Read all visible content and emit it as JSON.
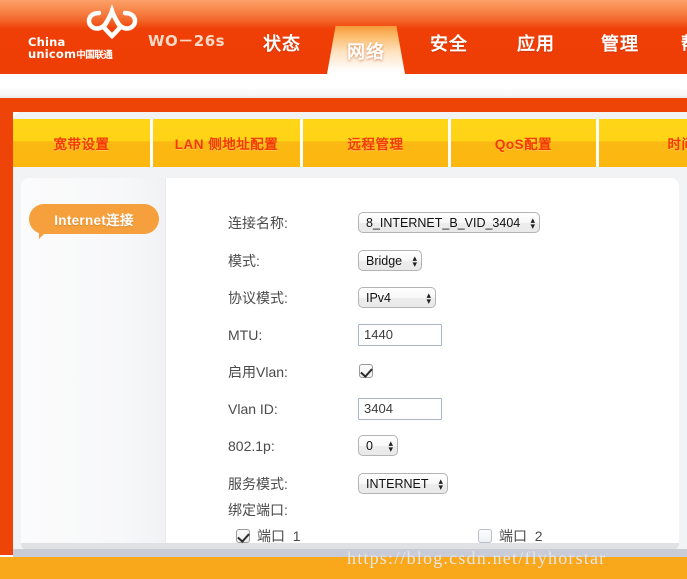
{
  "header": {
    "brand": {
      "line1": "China",
      "line2": "unicom",
      "line2_cn": "中国联通",
      "logo_icon": "unicom-knot-icon"
    },
    "model": "WO－26s",
    "nav": [
      {
        "label": "状态",
        "active": false
      },
      {
        "label": "网络",
        "active": true
      },
      {
        "label": "安全",
        "active": false
      },
      {
        "label": "应用",
        "active": false
      },
      {
        "label": "管理",
        "active": false
      },
      {
        "label": "帮",
        "active": false
      }
    ]
  },
  "subtabs": [
    {
      "label": "宽带设置"
    },
    {
      "label": "LAN 侧地址配置"
    },
    {
      "label": "远程管理"
    },
    {
      "label": "QoS配置"
    },
    {
      "label": "时间管理"
    }
  ],
  "sidebar": {
    "items": [
      {
        "label": "Internet连接",
        "active": true
      }
    ]
  },
  "form": {
    "rows": [
      {
        "label": "连接名称:",
        "type": "select",
        "value": "8_INTERNET_B_VID_3404"
      },
      {
        "label": "模式:",
        "type": "select",
        "value": "Bridge"
      },
      {
        "label": "协议模式:",
        "type": "select",
        "value": "IPv4"
      },
      {
        "label": "MTU:",
        "type": "text",
        "value": "1440"
      },
      {
        "label": "启用Vlan:",
        "type": "checkbox",
        "checked": true
      },
      {
        "label": "Vlan ID:",
        "type": "text",
        "value": "3404"
      },
      {
        "label": "802.1p:",
        "type": "select",
        "value": "0"
      },
      {
        "label": "服务模式:",
        "type": "select",
        "value": "INTERNET"
      },
      {
        "label": "绑定端口:",
        "type": "label"
      }
    ],
    "ports": [
      {
        "label": "端口_1",
        "checked": true
      },
      {
        "label": "端口_2",
        "checked": false
      }
    ]
  },
  "watermark": "https://blog.csdn.net/flyhorstar",
  "colors": {
    "header_orange": "#ee3d05",
    "frame_orange": "#ef4408",
    "bottom_amber": "#f9a81c",
    "subtab_yellow": "#ffd518",
    "subtab_amber": "#fcb70f",
    "subtab_text": "#f23b00",
    "sidebar_active": "#f5a03c"
  }
}
